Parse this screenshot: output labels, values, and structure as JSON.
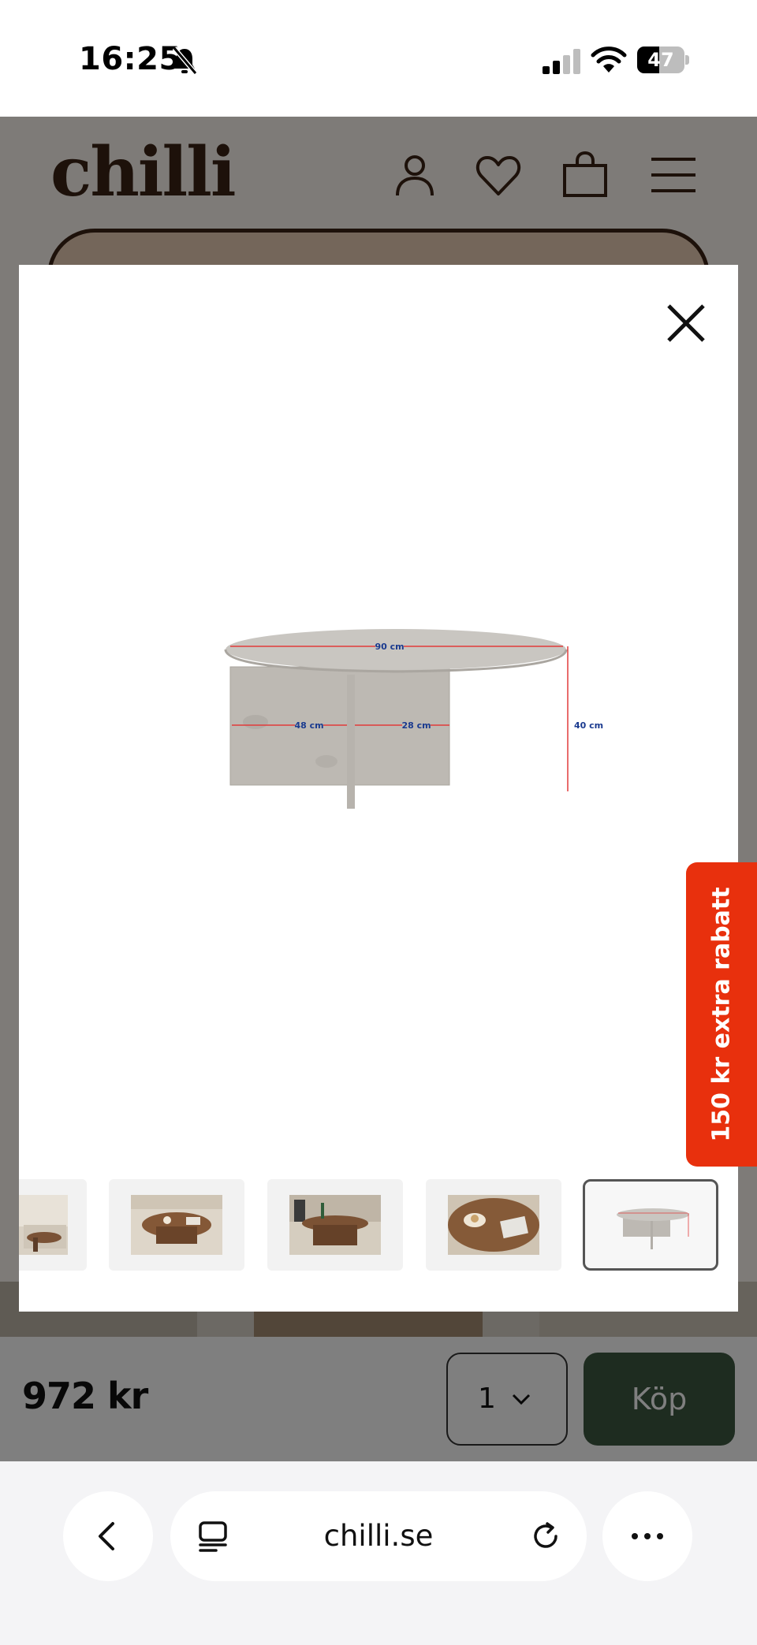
{
  "status_bar": {
    "time": "16:25",
    "battery": "47",
    "battery_level": 0.47,
    "icons": [
      "bell-slash-icon",
      "cellular-signal-icon",
      "wifi-icon",
      "battery-icon"
    ]
  },
  "site": {
    "logo": "chilli",
    "header_icons": [
      "account-icon",
      "heart-icon",
      "shopping-bag-icon",
      "menu-icon"
    ],
    "buy_bar": {
      "price": "972 kr",
      "quantity": "1",
      "buy_label": "Köp"
    },
    "colors": {
      "brand_brown": "#3b2314",
      "buy_green": "#3d5840",
      "promo_red": "#e8300d"
    }
  },
  "modal": {
    "close_icon": "close-icon",
    "image_labels": {
      "width": "90 cm",
      "depth_a": "48 cm",
      "depth_b": "28 cm",
      "height": "40 cm"
    },
    "thumbnail_count": 5,
    "active_thumbnail": 5
  },
  "promo": {
    "text": "150 kr extra rabatt"
  },
  "browser": {
    "address": "chilli.se",
    "icons": [
      "back-icon",
      "tabs-icon",
      "reload-icon",
      "more-icon"
    ]
  }
}
